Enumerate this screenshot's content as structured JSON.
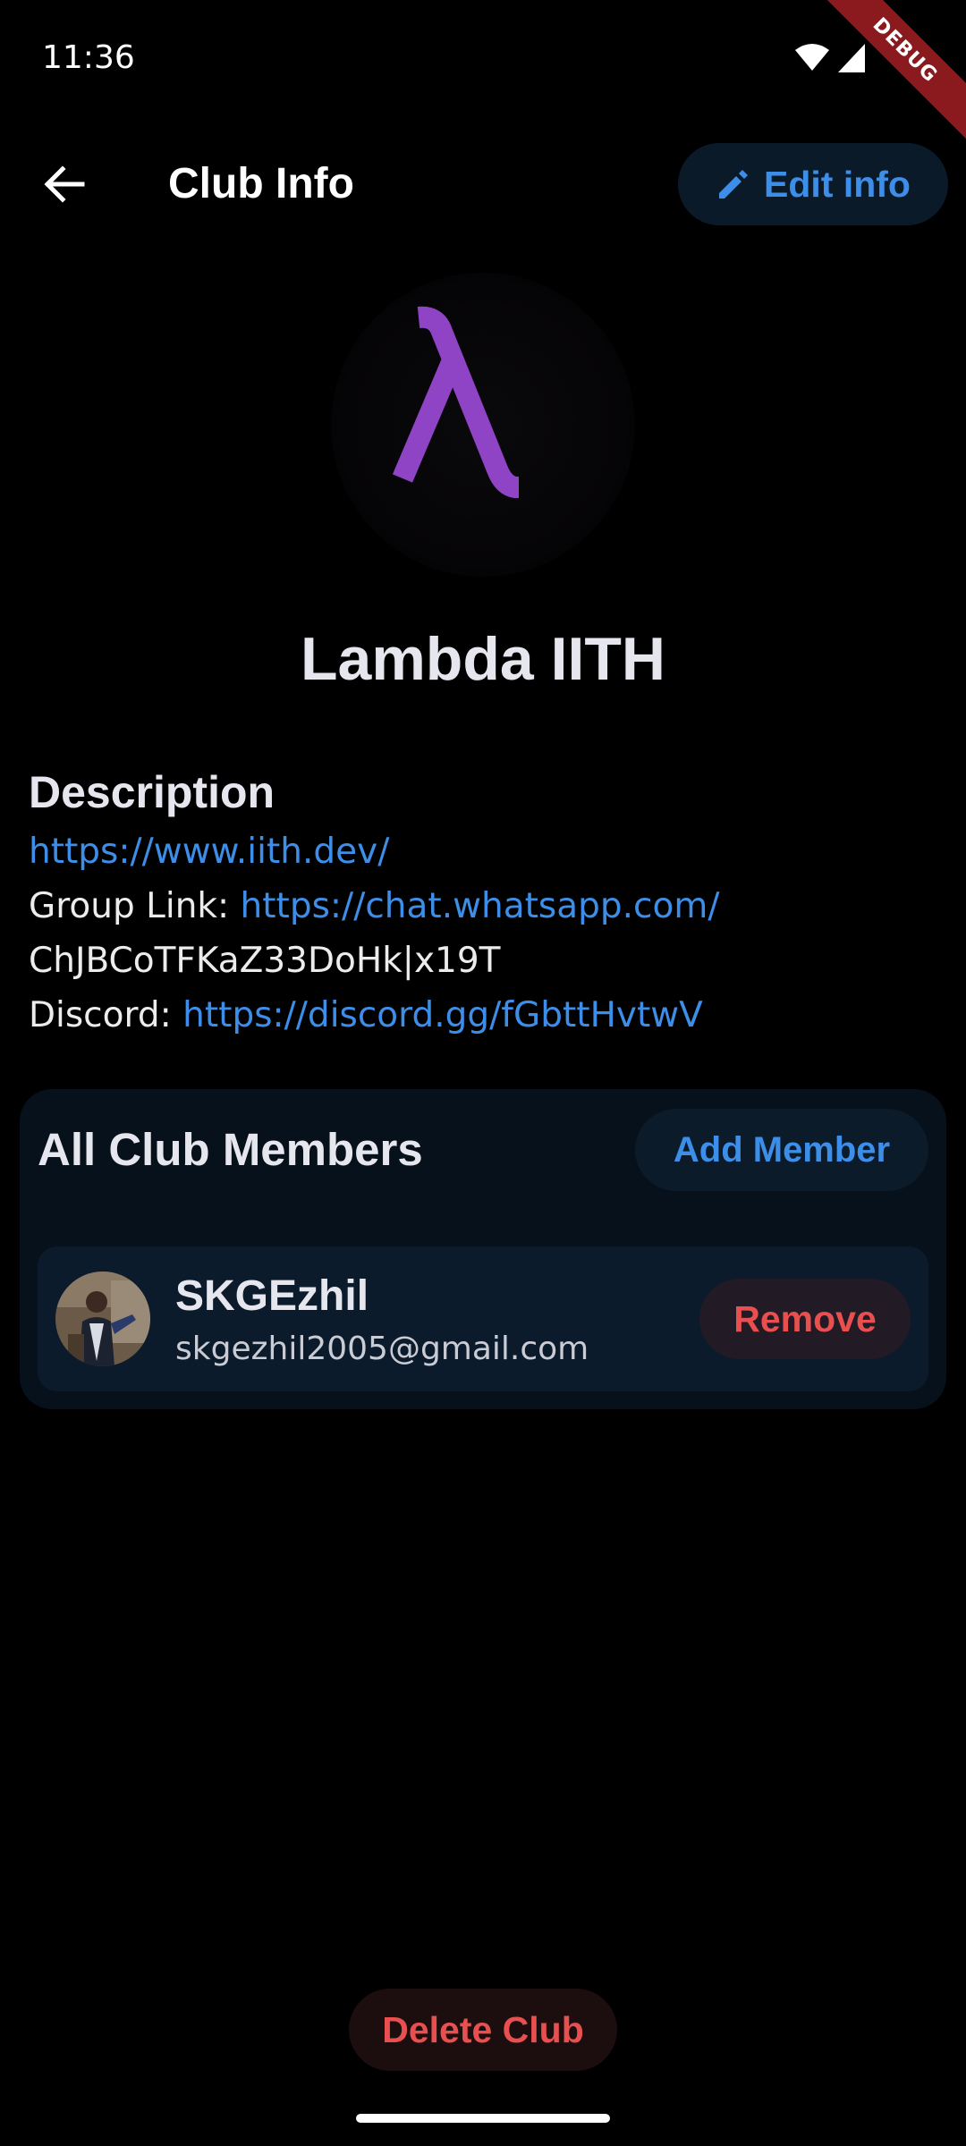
{
  "status_bar": {
    "time": "11:36",
    "debug_label": "DEBUG",
    "icons": [
      "wifi-icon",
      "cellular-signal-icon"
    ]
  },
  "app_bar": {
    "title": "Club Info",
    "back_icon": "arrow-back-icon",
    "edit_button": {
      "label": "Edit info",
      "icon": "pencil-icon"
    }
  },
  "club": {
    "name": "Lambda IITH",
    "logo_icon": "lambda-logo"
  },
  "description": {
    "heading": "Description",
    "website": "https://www.iith.dev/",
    "group_link_label": "Group Link: ",
    "group_link_url_1": "https://chat.whatsapp.com/",
    "group_link_url_2": "ChJBCoTFKaZ33DoHk|x19T",
    "discord_label": "Discord: ",
    "discord_url": "https://discord.gg/fGbttHvtwV"
  },
  "members": {
    "title": "All Club Members",
    "add_button_label": "Add Member",
    "list": [
      {
        "name": "SKGEzhil",
        "email": "skgezhil2005@gmail.com",
        "remove_label": "Remove"
      }
    ]
  },
  "footer": {
    "delete_button_label": "Delete Club"
  },
  "colors": {
    "background": "#000000",
    "accent_blue": "#3d8ee8",
    "danger_red": "#e8504f",
    "card_bg": "#06111b",
    "tile_bg": "#0c1b2c",
    "logo_purple": "#8e44c4"
  }
}
